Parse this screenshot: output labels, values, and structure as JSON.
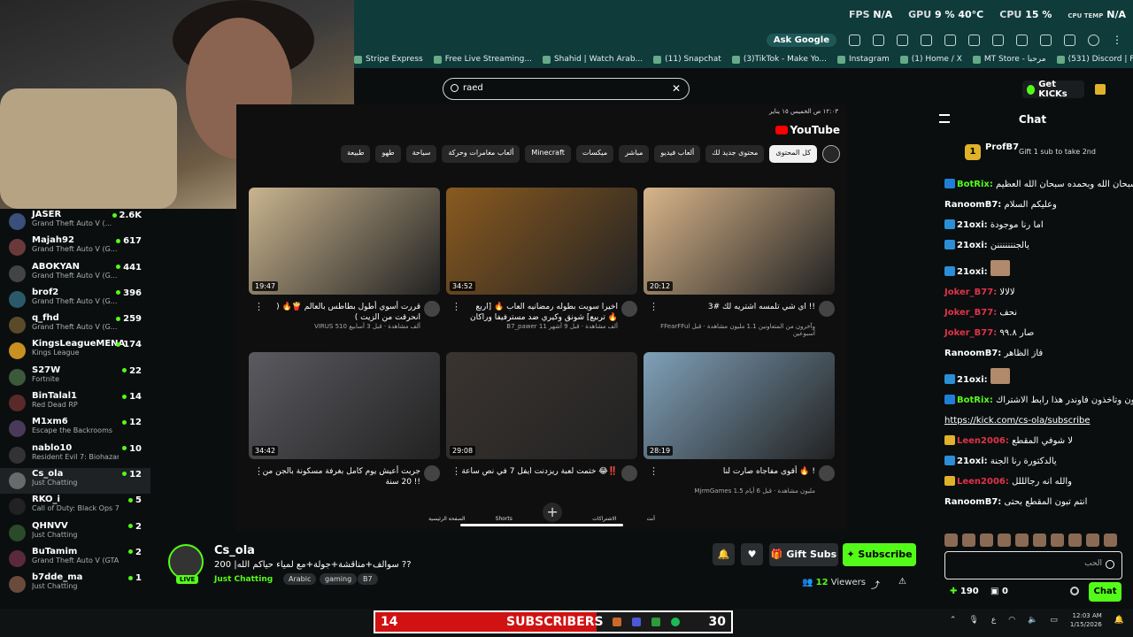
{
  "overlay": {
    "fps_label": "FPS",
    "fps": "N/A",
    "gpu_label": "GPU",
    "gpu_pct": "9 %",
    "gpu_temp": "40°C",
    "cpu_label": "CPU",
    "cpu_pct": "15 %",
    "cpu_temp_label": "CPU TEMP",
    "cpu_temp": "N/A"
  },
  "browser": {
    "ask_google": "Ask Google",
    "bookmarks": [
      "Stripe Express",
      "Free Live Streaming...",
      "Shahid | Watch Arab...",
      "(11) Snapchat",
      "(3)TikTok - Make Yo...",
      "Instagram",
      "(1) Home / X",
      "MT Store - مرحبا",
      "(531) Discord | Frien..."
    ]
  },
  "site": {
    "search_value": "raed",
    "get_kicks": "Get KICKs"
  },
  "sidebar": {
    "channels": [
      {
        "name": "JASER",
        "game": "Grand Theft Auto V (...",
        "viewers": "2.6K"
      },
      {
        "name": "Majah92",
        "game": "Grand Theft Auto V (G...",
        "viewers": "617"
      },
      {
        "name": "ABOKYAN",
        "game": "Grand Theft Auto V (G...",
        "viewers": "441"
      },
      {
        "name": "brof2",
        "game": "Grand Theft Auto V (G...",
        "viewers": "396"
      },
      {
        "name": "q_fhd",
        "game": "Grand Theft Auto V (G...",
        "viewers": "259"
      },
      {
        "name": "KingsLeagueMENA",
        "game": "Kings League",
        "viewers": "174"
      },
      {
        "name": "S27W",
        "game": "Fortnite",
        "viewers": "22"
      },
      {
        "name": "BinTalal1",
        "game": "Red Dead RP",
        "viewers": "14"
      },
      {
        "name": "M1xm6",
        "game": "Escape the Backrooms",
        "viewers": "12"
      },
      {
        "name": "nablo10",
        "game": "Resident Evil 7: Biohazard",
        "viewers": "10"
      },
      {
        "name": "Cs_ola",
        "game": "Just Chatting",
        "viewers": "12"
      },
      {
        "name": "RKO_i",
        "game": "Call of Duty: Black Ops 7",
        "viewers": "5"
      },
      {
        "name": "QHNVV",
        "game": "Just Chatting",
        "viewers": "2"
      },
      {
        "name": "BuTamim",
        "game": "Grand Theft Auto V (GTA)",
        "viewers": "2"
      },
      {
        "name": "b7dde_ma",
        "game": "Just Chatting",
        "viewers": "1"
      }
    ]
  },
  "youtube": {
    "date": "١٢:٠٣ ص  الخميس ١٥ يناير",
    "logo": "YouTube",
    "chips": [
      "كل المحتوى",
      "محتوى جديد لك",
      "ألعاب فيديو",
      "مباشر",
      "ميكسات",
      "Minecraft",
      "ألعاب مغامرات وحركة",
      "سياحة",
      "طهو",
      "طبيعة"
    ],
    "videos": [
      {
        "title": "اي شي تلمسه اشتريه لك #3 !!",
        "meta": "FFearFFul وآخرون من المتعاونين 1.1 مليون مشاهدة · قبل أسبوعين",
        "dur": "20:12",
        "color": "#d8b58a"
      },
      {
        "title": "اخيرا سويت بطوله رمضانيه العاب 🔥 [اربع تربيع] شونق وكيري ضد مسترفيفا وراكان 🔥",
        "meta": "B7_pawer 11 ألف مشاهدة · قبل 9 أشهر",
        "dur": "34:52",
        "color": "#8a5a20"
      },
      {
        "title": "قررت أسوي أطول بطاطس بالعالم 🍟🔥 ( انحرقت من الزيت )",
        "meta": "VIRUS 510 ألف مشاهدة · قبل 3 أسابيع",
        "dur": "19:47",
        "color": "#c9b48e"
      },
      {
        "title": "أقوى مفاجاه صارت لنا 🔥 !",
        "meta": "MjrmGames 1.5 مليون مشاهدة · قبل 6 أيام",
        "dur": "28:19",
        "color": "#7fa0b8"
      },
      {
        "title": "ختمت لعبة ريزدنت ايفل 7 في نص ساعة 😂‼️",
        "meta": "",
        "dur": "29:08",
        "color": "#3a3430"
      },
      {
        "title": "جربت أعيش يوم كامل بغرفة مسكونة بالجن من 20 سنة !!",
        "meta": "",
        "dur": "34:42",
        "color": "#5a5a60"
      }
    ],
    "nav": [
      "الصفحة الرئيسية",
      "Shorts",
      "",
      "الاشتراكات",
      "أنت"
    ]
  },
  "stream": {
    "name": "Cs_ola",
    "live": "LIVE",
    "title": "200 |سوالف+مناقشة+جولة+مع لمياء حياكم الله ??",
    "category": "Just Chatting",
    "tags": [
      "Arabic",
      "gaming",
      "B7"
    ],
    "gift_subs": "Gift Subs",
    "subscribe": "Subscribe",
    "viewers": "12",
    "viewers_label": "Viewers"
  },
  "chat": {
    "title": "Chat",
    "pinned_user": "ProfB7",
    "pinned_level": "1",
    "pinned_text": "Gift 1 sub to take 2nd",
    "messages": [
      {
        "user": "BotRix:",
        "text": "سبحان الله وبحمده سبحان الله العظيم",
        "color": "#53fc18",
        "badge": "#1f7fd6"
      },
      {
        "user": "RanoomB7:",
        "text": "وعليكم السلام",
        "color": "#fff",
        "badge": ""
      },
      {
        "user": "21oxi:",
        "text": "اما رنا موجودة",
        "color": "#fff",
        "badge": "#2a8fd6"
      },
      {
        "user": "21oxi:",
        "text": "يالجنننننننن",
        "color": "#fff",
        "badge": "#2a8fd6"
      },
      {
        "user": "21oxi:",
        "text": "",
        "color": "#fff",
        "badge": "#2a8fd6"
      },
      {
        "user": "Joker_B77:",
        "text": "لالالا",
        "color": "#e0334a",
        "badge": ""
      },
      {
        "user": "Joker_B77:",
        "text": "نحف",
        "color": "#e0334a",
        "badge": ""
      },
      {
        "user": "Joker_B77:",
        "text": "صار ٩٩.٨",
        "color": "#e0334a",
        "badge": ""
      },
      {
        "user": "RanoomB7:",
        "text": "فاز الظاهر",
        "color": "#fff",
        "badge": ""
      },
      {
        "user": "21oxi:",
        "text": "",
        "color": "#fff",
        "badge": "#2a8fd6"
      },
      {
        "user": "BotRix:",
        "text": "اذا حابين تشتركون وتاخذون فاوندر هذا رابط الاشتراك",
        "color": "#53fc18",
        "badge": "#1f7fd6"
      },
      {
        "user": "",
        "text": "https://kick.com/cs-ola/subscribe",
        "color": "#fff",
        "badge": "",
        "link": true
      },
      {
        "user": "Leen2006:",
        "text": "لا شوفي المقطع",
        "color": "#e0334a",
        "badge": "#e0b12a"
      },
      {
        "user": "21oxi:",
        "text": "يالدكتورة رنا الجنة",
        "color": "#fff",
        "badge": "#2a8fd6"
      },
      {
        "user": "Leen2006:",
        "text": "والله انه رجالللل",
        "color": "#e0334a",
        "badge": "#e0b12a"
      },
      {
        "user": "RanoomB7:",
        "text": "انتم تبون المقطع بحتى",
        "color": "#fff",
        "badge": ""
      }
    ],
    "input_text": "الحب",
    "points": "190",
    "drops": "0",
    "chat_button": "Chat"
  },
  "subbar": {
    "count": "14",
    "label": "SUBSCRIBERS",
    "goal": "30"
  },
  "tray": {
    "time": "12:03 AM",
    "date": "1/15/2026"
  }
}
